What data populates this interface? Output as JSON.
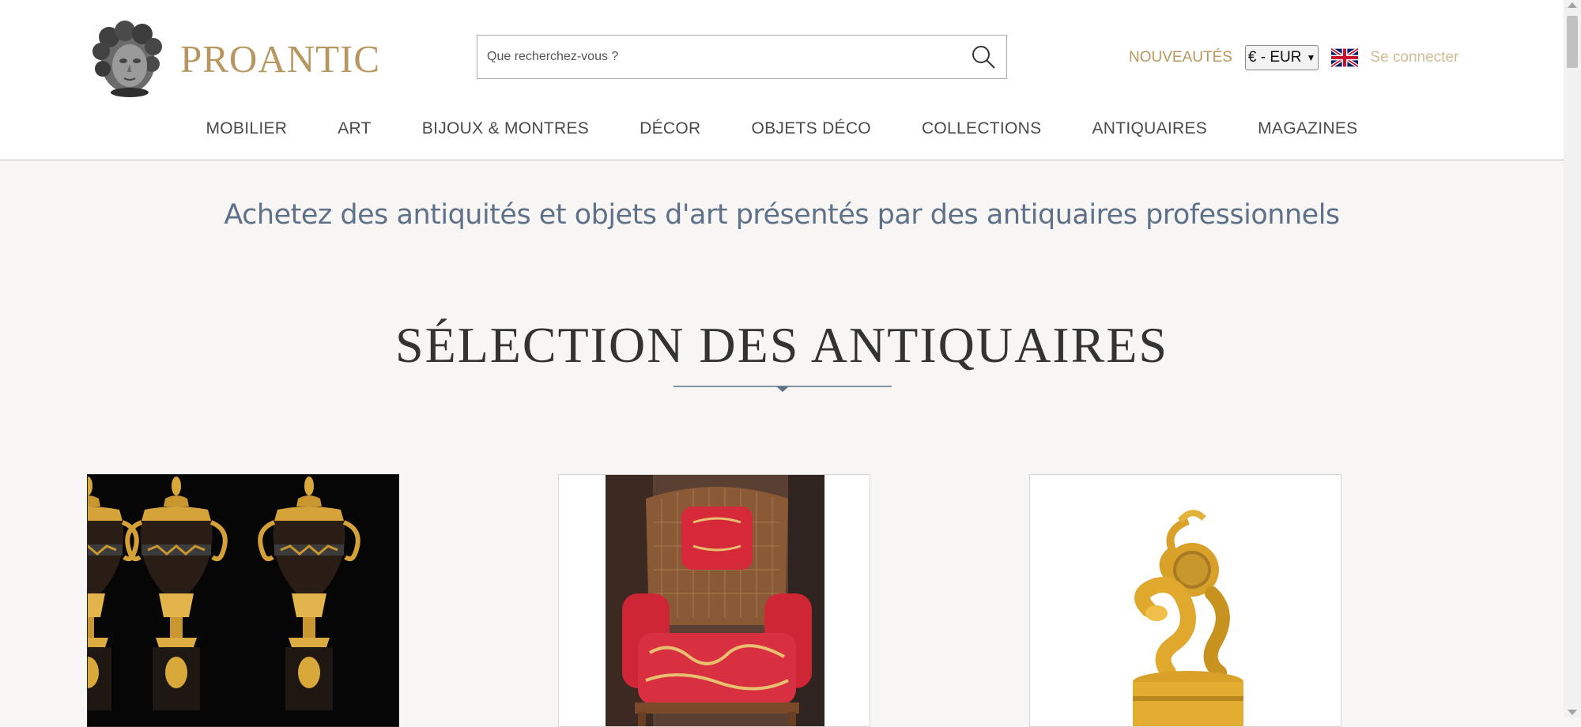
{
  "header": {
    "logo_text": "PROANTIC",
    "search": {
      "placeholder": "Que recherchez-vous ?"
    },
    "nouveautes": "NOUVEAUTÉS",
    "currency": "€ - EUR",
    "language_flag": "uk-flag-icon",
    "login": "Se connecter"
  },
  "nav": {
    "items": [
      {
        "label": "MOBILIER"
      },
      {
        "label": "ART"
      },
      {
        "label": "BIJOUX & MONTRES"
      },
      {
        "label": "DÉCOR"
      },
      {
        "label": "OBJETS DÉCO"
      },
      {
        "label": "COLLECTIONS"
      },
      {
        "label": "ANTIQUAIRES"
      },
      {
        "label": "MAGAZINES"
      }
    ]
  },
  "main": {
    "tagline": "Achetez des antiquités et objets d'art présentés par des antiquaires professionnels",
    "section_title": "SÉLECTION DES ANTIQUAIRES",
    "cards": [
      {
        "image": "pair-of-bronze-urns-image"
      },
      {
        "image": "red-damask-armchair-image"
      },
      {
        "image": "gilt-bronze-clock-image"
      }
    ]
  },
  "colors": {
    "brand_gold": "#b7975f",
    "tagline_blue": "#5f7089",
    "page_background": "#f7f6f4"
  }
}
